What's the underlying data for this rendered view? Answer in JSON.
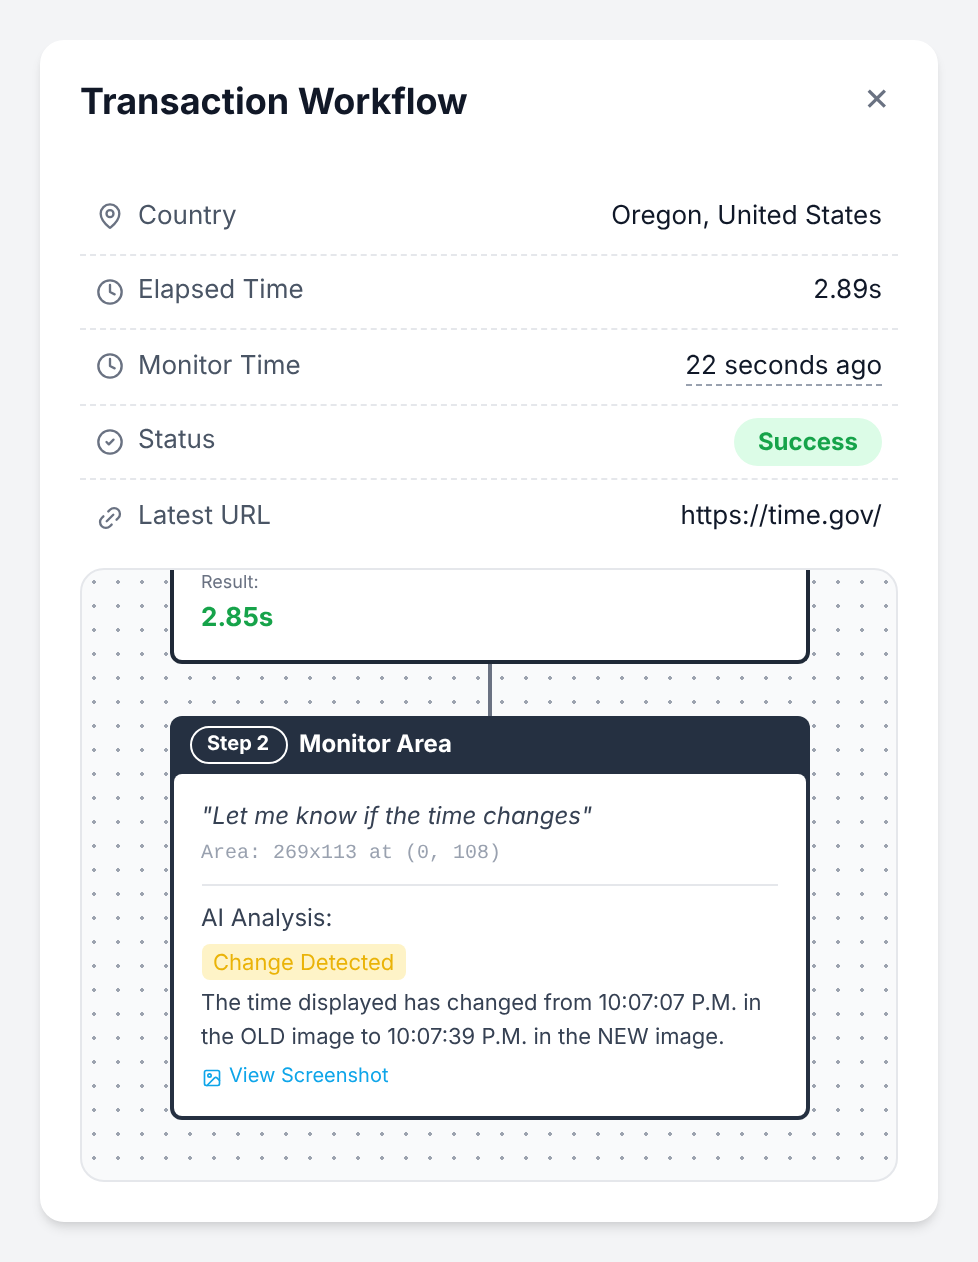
{
  "dialog": {
    "title": "Transaction Workflow",
    "close": "×"
  },
  "details": [
    {
      "label": "Country",
      "value": "Oregon, United States",
      "kind": "text"
    },
    {
      "label": "Elapsed Time",
      "value": "2.89s",
      "kind": "text"
    },
    {
      "label": "Monitor Time",
      "value": "22 seconds ago",
      "kind": "relative-time"
    },
    {
      "label": "Status",
      "value": "Success",
      "kind": "badge"
    },
    {
      "label": "Latest URL",
      "value": "https://time.gov/",
      "kind": "text"
    }
  ],
  "workflow": {
    "previous_step": {
      "result_label": "Result:",
      "result": "2.85s"
    },
    "step": {
      "badge": "Step 2",
      "title": "Monitor Area",
      "prompt": "\"Let me know if the time changes\"",
      "area": "Area: 269x113 at (0, 108)",
      "analysis_label": "AI Analysis:",
      "analysis_tag": "Change Detected",
      "analysis": "The time displayed has changed from 10:07:07 P.M. in the OLD image to 10:07:39 P.M. in the NEW image.",
      "link": "View Screenshot"
    }
  }
}
